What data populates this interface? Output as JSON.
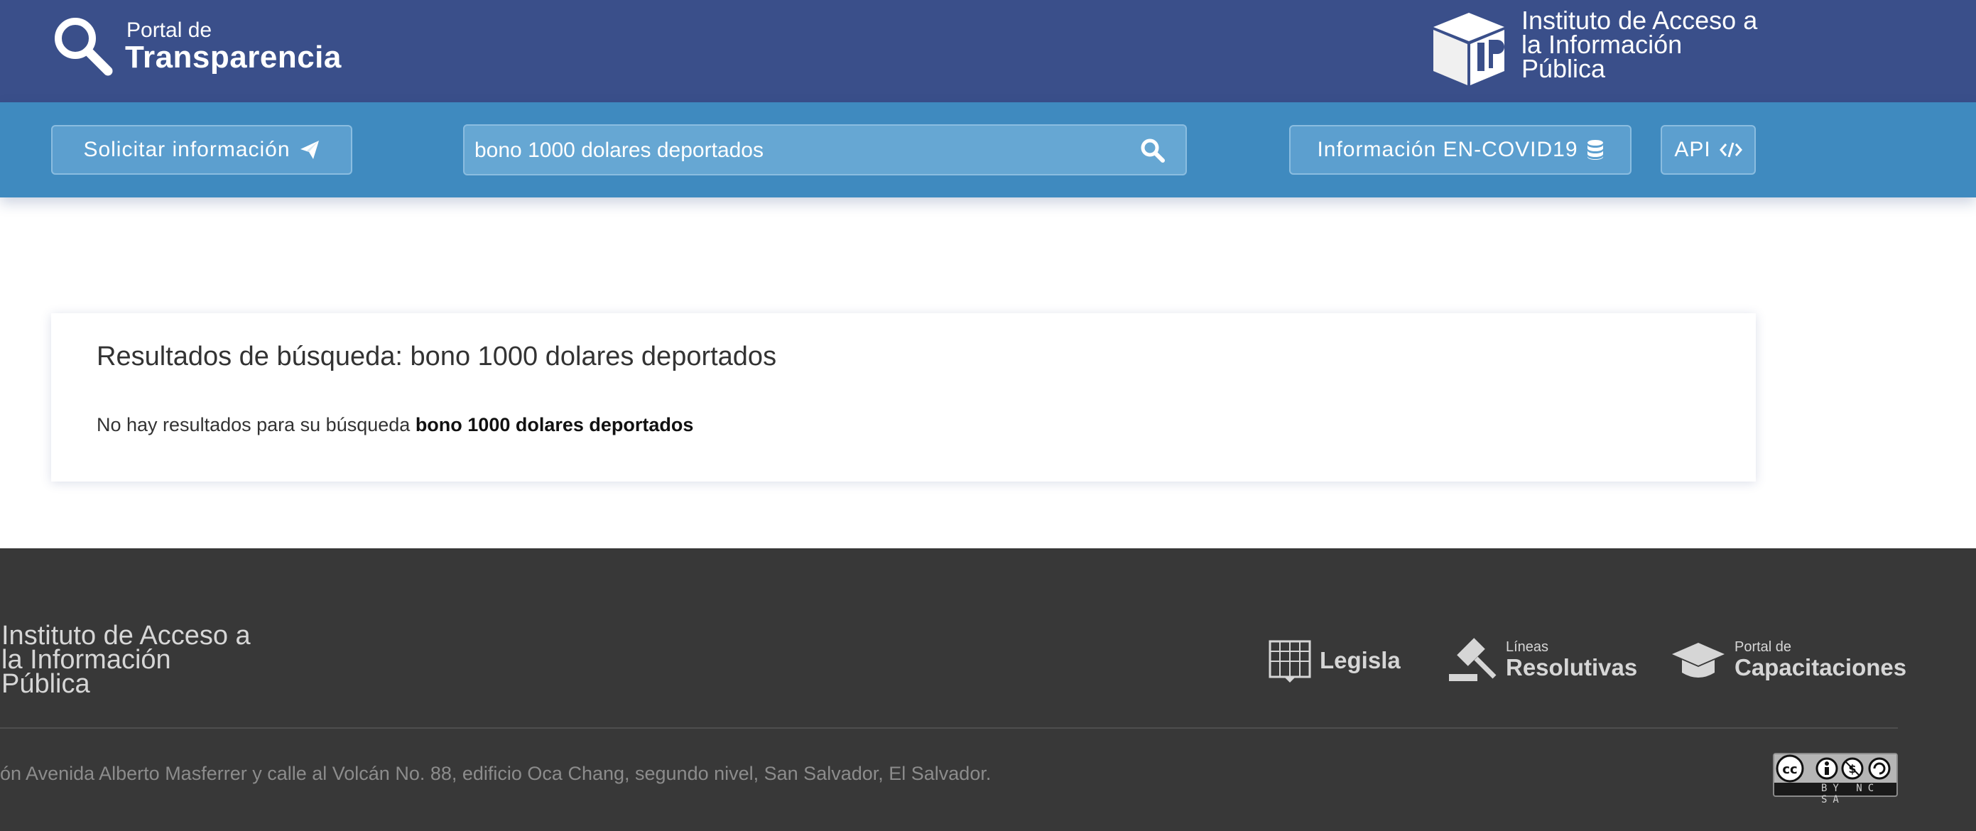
{
  "header": {
    "portal_small": "Portal de",
    "portal_big": "Transparencia",
    "institute_name": "Instituto de Acceso a la Información Pública"
  },
  "nav": {
    "solicitar_label": "Solicitar información",
    "search_value": "bono 1000 dolares deportados",
    "covid_label": "Información EN-COVID19",
    "api_label": "API"
  },
  "results": {
    "title": "Resultados de búsqueda: bono 1000 dolares deportados",
    "no_results_prefix": "No hay resultados para su búsqueda",
    "query": "bono 1000 dolares deportados"
  },
  "footer": {
    "institute_name": "Instituto de Acceso a la Información Pública",
    "links": {
      "legisla": "Legisla",
      "lineas_small": "Líneas",
      "lineas_big": "Resolutivas",
      "capac_small": "Portal de",
      "capac_big": "Capacitaciones"
    },
    "address": "ón Avenida Alberto Masferrer y calle al Volcán No. 88, edificio Oca Chang, segundo nivel, San Salvador, El Salvador.",
    "license_terms": "BY NC SA"
  },
  "colors": {
    "header_bg": "#3a4f8a",
    "nav_bg": "#3f8abf",
    "footer_bg": "#383838"
  }
}
